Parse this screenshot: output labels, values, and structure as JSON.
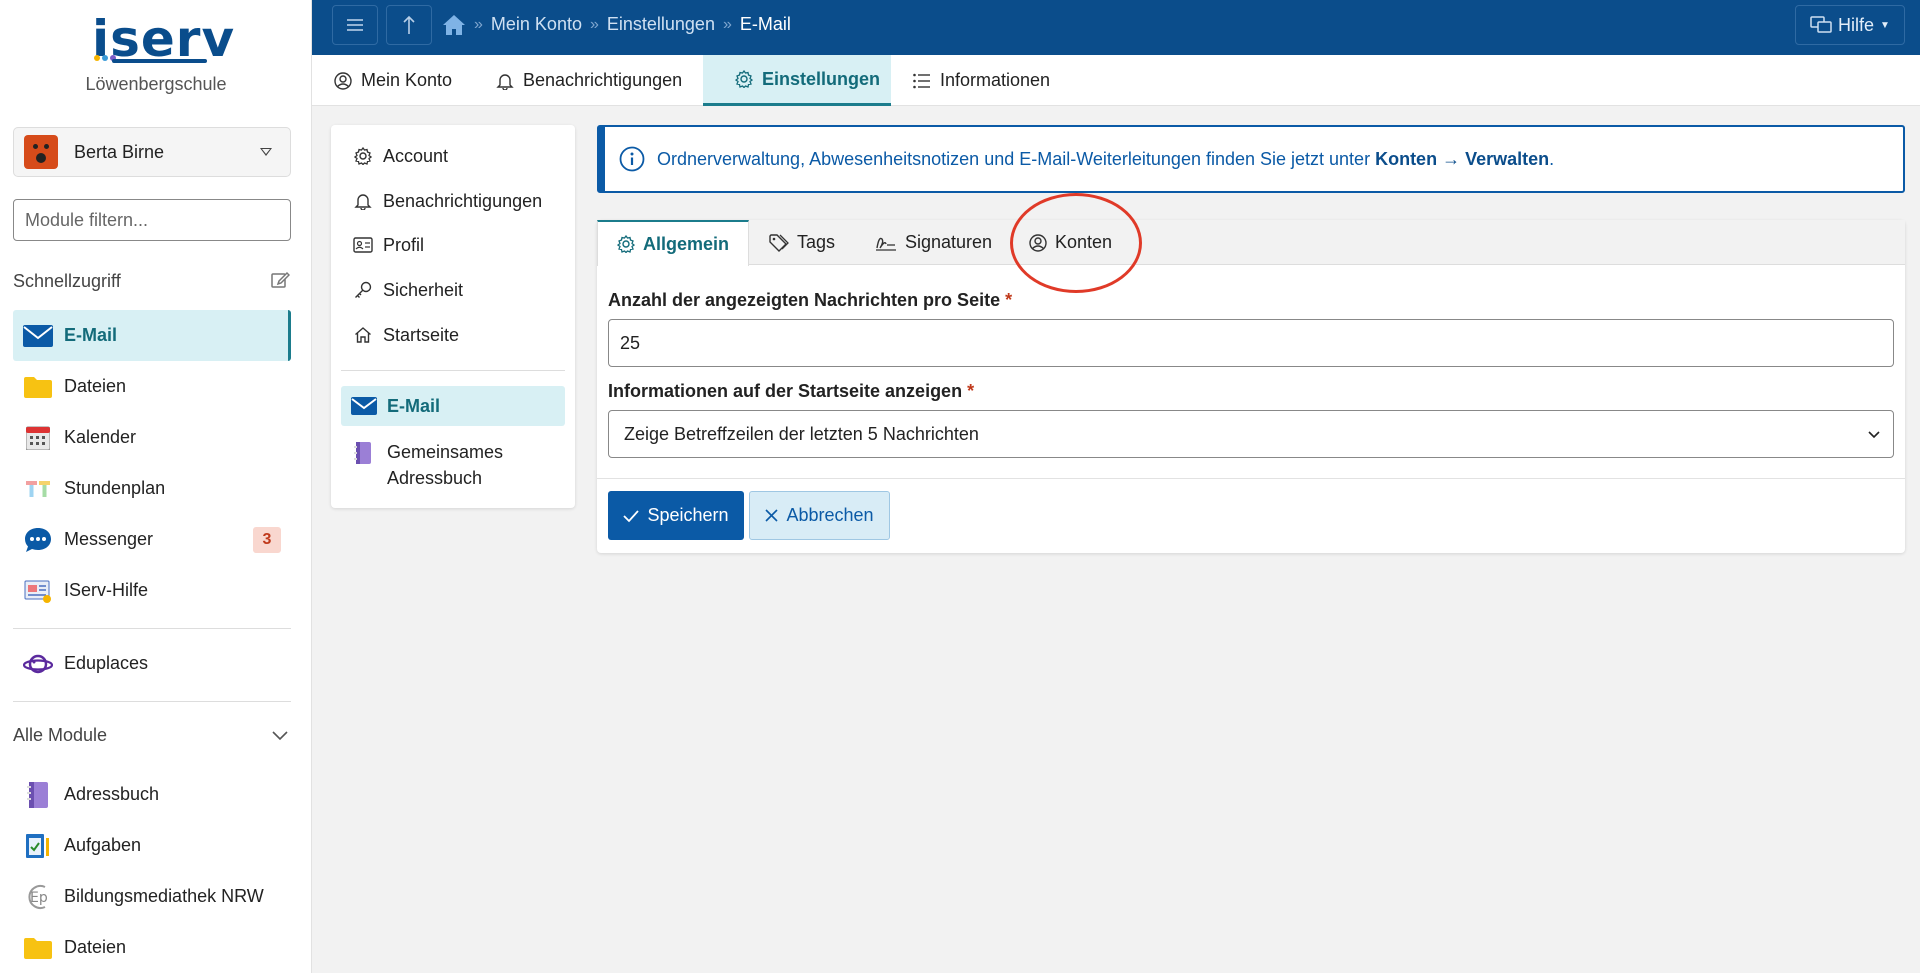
{
  "brand": {
    "logo_text": "iserv",
    "school": "Löwenbergschule"
  },
  "user": {
    "name": "Berta Birne"
  },
  "sidebar": {
    "filter_placeholder": "Module filtern...",
    "quick_access_label": "Schnellzugriff",
    "quick_items": [
      {
        "label": "E-Mail",
        "icon": "mail-icon"
      },
      {
        "label": "Dateien",
        "icon": "folder-icon"
      },
      {
        "label": "Kalender",
        "icon": "calendar-icon"
      },
      {
        "label": "Stundenplan",
        "icon": "timetable-icon"
      },
      {
        "label": "Messenger",
        "icon": "chat-icon",
        "badge": "3"
      },
      {
        "label": "IServ-Hilfe",
        "icon": "help-book-icon"
      }
    ],
    "eduplaces_label": "Eduplaces",
    "all_modules_label": "Alle Module",
    "all_items": [
      {
        "label": "Adressbuch",
        "icon": "address-book-icon"
      },
      {
        "label": "Aufgaben",
        "icon": "tasks-icon"
      },
      {
        "label": "Bildungsmediathek NRW",
        "icon": "ep-icon"
      },
      {
        "label": "Dateien",
        "icon": "folder-icon"
      }
    ]
  },
  "topbar": {
    "breadcrumbs": [
      "Mein Konto",
      "Einstellungen",
      "E-Mail"
    ],
    "help_label": "Hilfe"
  },
  "account_tabs": [
    {
      "label": "Mein Konto",
      "icon": "user-circle-icon"
    },
    {
      "label": "Benachrichtigungen",
      "icon": "bell-icon"
    },
    {
      "label": "Einstellungen",
      "icon": "gear-icon",
      "active": true
    },
    {
      "label": "Informationen",
      "icon": "list-icon"
    }
  ],
  "settings_menu": {
    "items": [
      {
        "label": "Account",
        "icon": "gear-icon"
      },
      {
        "label": "Benachrichtigungen",
        "icon": "bell-icon"
      },
      {
        "label": "Profil",
        "icon": "id-card-icon"
      },
      {
        "label": "Sicherheit",
        "icon": "key-icon"
      },
      {
        "label": "Startseite",
        "icon": "home-icon"
      }
    ],
    "active_label": "E-Mail",
    "addressbook_line1": "Gemeinsames",
    "addressbook_line2": "Adressbuch"
  },
  "info": {
    "text": "Ordnerverwaltung, Abwesenheitsnotizen und E-Mail-Weiterleitungen finden Sie jetzt unter ",
    "link1": "Konten",
    "arrow": " → ",
    "link2": "Verwalten",
    "end": "."
  },
  "mail_tabs": [
    {
      "label": "Allgemein",
      "icon": "gear-icon",
      "active": true
    },
    {
      "label": "Tags",
      "icon": "tag-icon"
    },
    {
      "label": "Signaturen",
      "icon": "signature-icon"
    },
    {
      "label": "Konten",
      "icon": "user-circle-icon"
    }
  ],
  "form": {
    "per_page_label": "Anzahl der angezeigten Nachrichten pro Seite",
    "per_page_value": "25",
    "startpage_label": "Informationen auf der Startseite anzeigen",
    "startpage_value": "Zeige Betreffzeilen der letzten 5 Nachrichten",
    "required_mark": "*",
    "save_label": "Speichern",
    "cancel_label": "Abbrechen"
  },
  "colors": {
    "primary": "#0b4d8b",
    "accent": "#1b7c8c",
    "highlight": "#e03a28"
  }
}
